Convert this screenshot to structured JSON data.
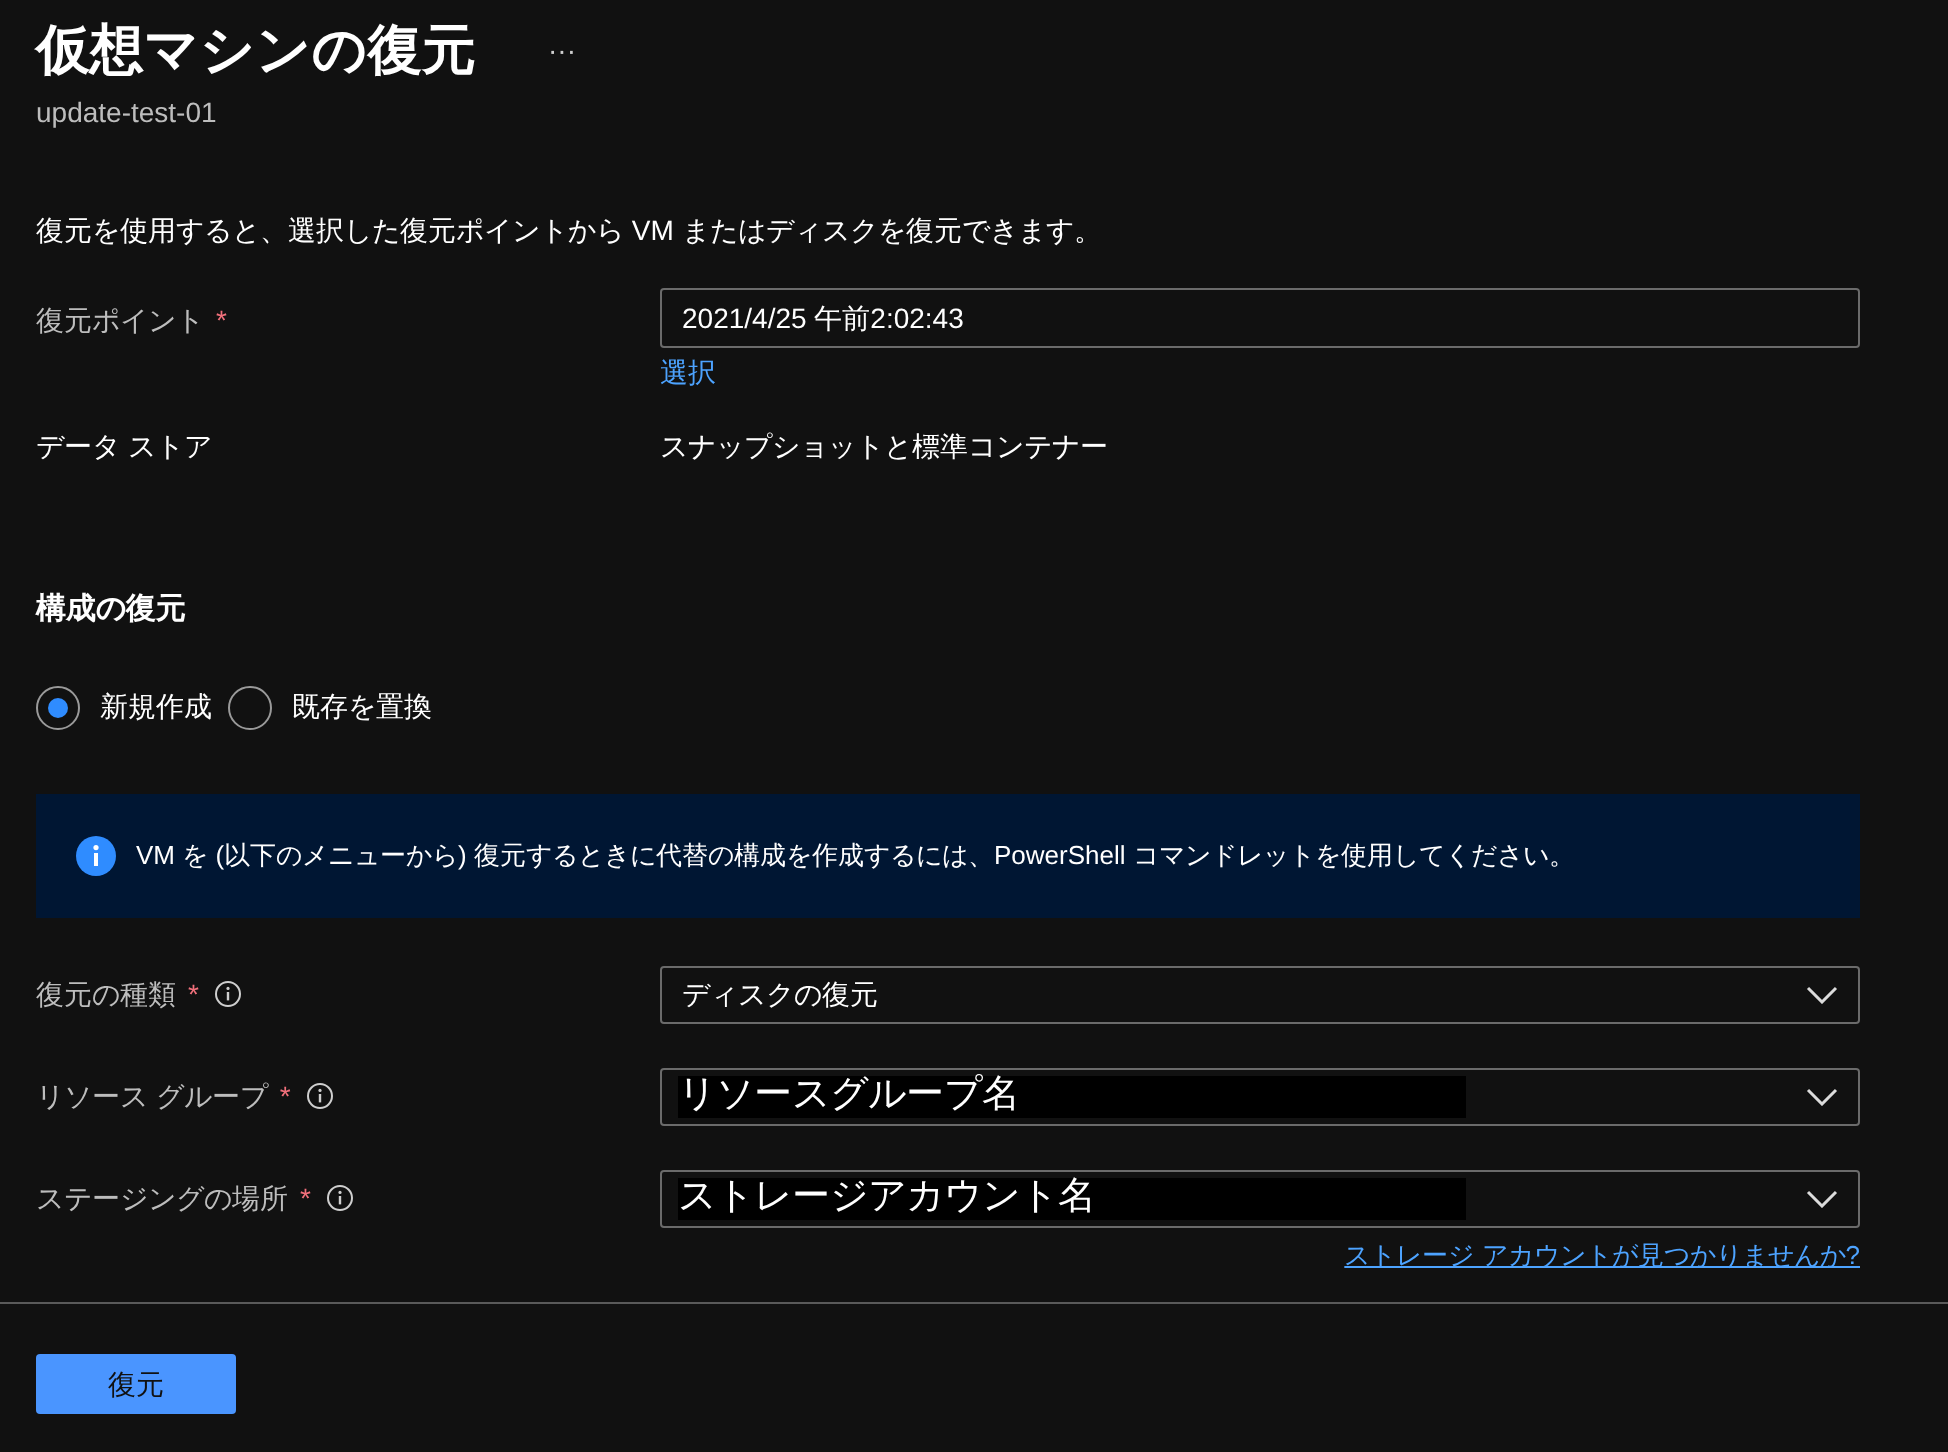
{
  "page": {
    "title": "仮想マシンの復元",
    "more": "···",
    "subtitle": "update-test-01"
  },
  "description": "復元を使用すると、選択した復元ポイントから VM またはディスクを復元できます。",
  "restore_point": {
    "label": "復元ポイント",
    "required_mark": "*",
    "value": "2021/4/25 午前2:02:43",
    "link": "選択"
  },
  "data_store": {
    "label": "データ ストア",
    "value": "スナップショットと標準コンテナー"
  },
  "restore_config": {
    "heading": "構成の復元",
    "options": [
      {
        "label": "新規作成",
        "selected": true
      },
      {
        "label": "既存を置換",
        "selected": false
      }
    ]
  },
  "info_banner": "VM を (以下のメニューから) 復元するときに代替の構成を作成するには、PowerShell コマンドレットを使用してください。",
  "dropdowns": [
    {
      "label": "復元の種類",
      "required_mark": "*",
      "value": "ディスクの復元",
      "redacted": false
    },
    {
      "label": "リソース グループ",
      "required_mark": "*",
      "value": "リソースグループ名",
      "redacted": true
    },
    {
      "label": "ステージングの場所",
      "required_mark": "*",
      "value": "ストレージアカウント名",
      "redacted": true
    }
  ],
  "storage_link": "ストレージ アカウントが見つかりませんか?",
  "restore_button": "復元"
}
